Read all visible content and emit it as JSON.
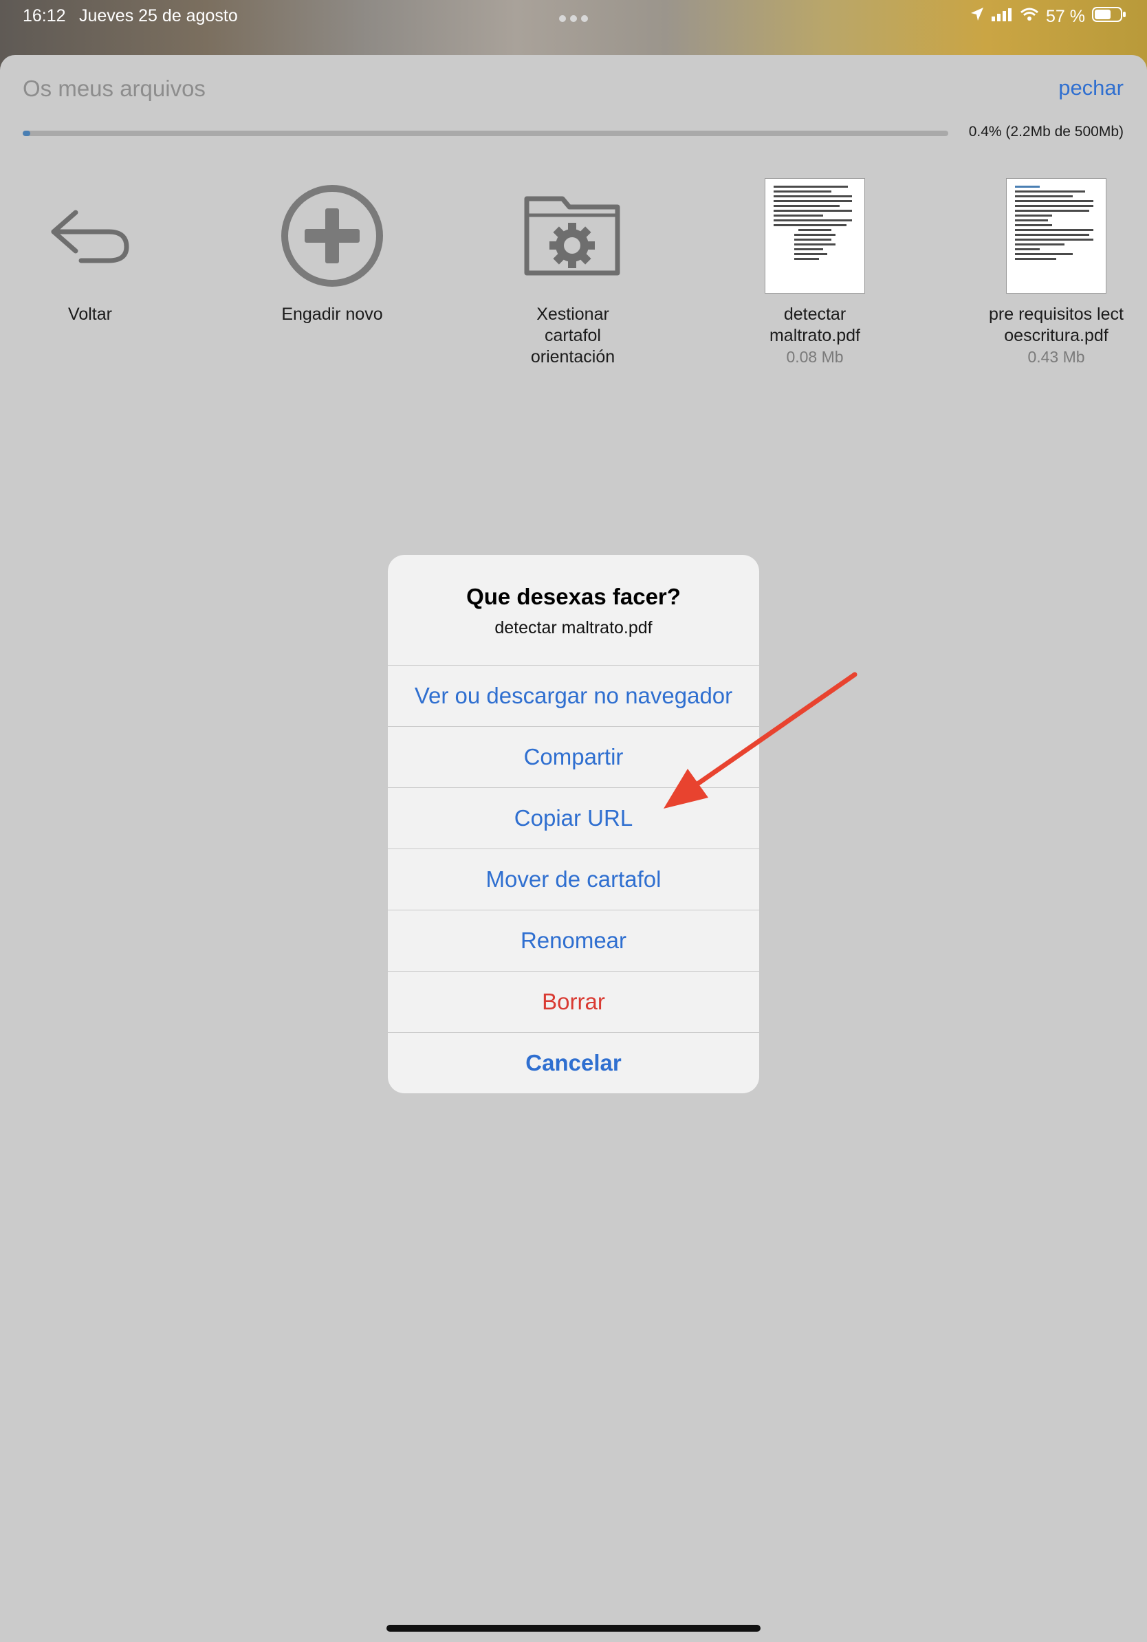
{
  "status_bar": {
    "time": "16:12",
    "date": "Jueves 25 de agosto",
    "battery": "57 %"
  },
  "sheet": {
    "title": "Os meus arquivos",
    "close_label": "pechar",
    "storage": {
      "used_fraction": 0.004,
      "text": "0.4% (2.2Mb de 500Mb)"
    }
  },
  "items": [
    {
      "label": "Voltar",
      "icon": "back-arrow-icon"
    },
    {
      "label": "Engadir novo",
      "icon": "plus-circle-icon"
    },
    {
      "label": "Xestionar cartafol orientación",
      "icon": "folder-gear-icon"
    },
    {
      "label": "detectar maltrato.pdf",
      "size": "0.08 Mb",
      "icon": "pdf-thumbnail"
    },
    {
      "label": "pre requisitos lectoescritura.pdf",
      "size": "0.43 Mb",
      "icon": "pdf-thumbnail"
    }
  ],
  "dialog": {
    "title": "Que desexas facer?",
    "subtitle": "detectar maltrato.pdf",
    "actions": [
      {
        "label": "Ver ou descargar no navegador"
      },
      {
        "label": "Compartir"
      },
      {
        "label": "Copiar URL"
      },
      {
        "label": "Mover de cartafol"
      },
      {
        "label": "Renomear"
      },
      {
        "label": "Borrar",
        "style": "destructive"
      }
    ],
    "cancel_label": "Cancelar"
  },
  "colors": {
    "accent": "#2f6fd0",
    "destructive": "#d93a32",
    "annotation": "#e8432f",
    "overlay": "#cbcbcb"
  }
}
